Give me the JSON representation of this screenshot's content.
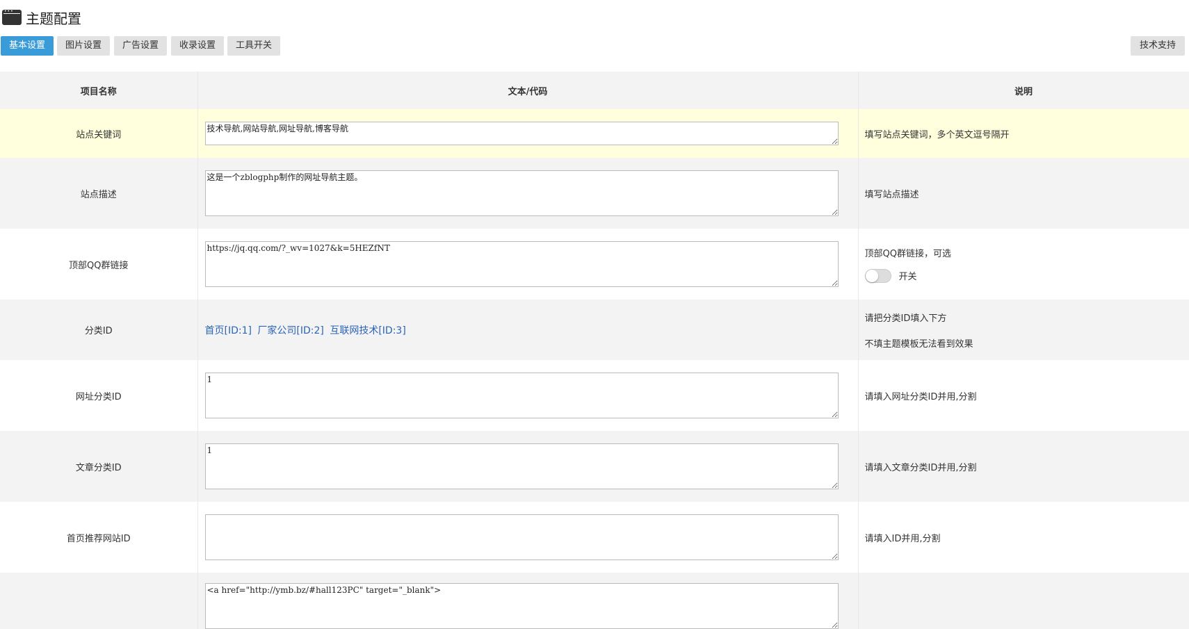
{
  "header": {
    "title": "主题配置"
  },
  "tabs": [
    "基本设置",
    "图片设置",
    "广告设置",
    "收录设置",
    "工具开关"
  ],
  "support_label": "技术支持",
  "table": {
    "headers": [
      "项目名称",
      "文本/代码",
      "说明"
    ],
    "rows": [
      {
        "name": "站点关键词",
        "value": "技术导航,网站导航,网址导航,博客导航",
        "desc": "填写站点关键词，多个英文逗号隔开"
      },
      {
        "name": "站点描述",
        "value": "这是一个zblogphp制作的网址导航主题。",
        "desc": "填写站点描述"
      },
      {
        "name": "顶部QQ群链接",
        "value": "https://jq.qq.com/?_wv=1027&k=5HEZfNT",
        "desc": "顶部QQ群链接，可选",
        "toggle_label": "开关",
        "toggle_on": false
      },
      {
        "name": "分类ID",
        "categories": [
          "首页[ID:1]",
          "厂家公司[ID:2]",
          "互联网技术[ID:3]"
        ],
        "desc": "请把分类ID填入下方",
        "desc2": "不填主题模板无法看到效果"
      },
      {
        "name": "网址分类ID",
        "value": "1",
        "desc": "请填入网址分类ID并用,分割"
      },
      {
        "name": "文章分类ID",
        "value": "1",
        "desc": "请填入文章分类ID并用,分割"
      },
      {
        "name": "首页推荐网站ID",
        "value": "",
        "desc": "请填入ID并用,分割"
      },
      {
        "name": "",
        "value": "<a href=\"http://ymb.bz/#hall123PC\" target=\"_blank\">",
        "desc": ""
      }
    ]
  },
  "colors": {
    "accent": "#3a9bd9",
    "highlight_row": "#ffffdd",
    "link": "#2a64b8"
  }
}
